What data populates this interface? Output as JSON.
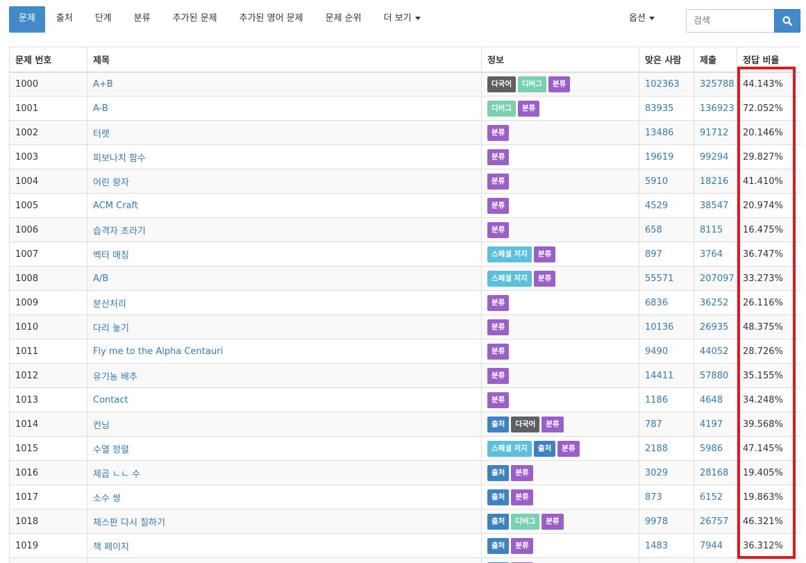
{
  "nav": {
    "tabs": [
      {
        "label": "문제",
        "active": true
      },
      {
        "label": "출처"
      },
      {
        "label": "단계"
      },
      {
        "label": "분류"
      },
      {
        "label": "추가된 문제"
      },
      {
        "label": "추가된 영어 문제"
      },
      {
        "label": "문제 순위"
      },
      {
        "label": "더 보기",
        "dropdown": true
      }
    ],
    "options_label": "옵션"
  },
  "search": {
    "placeholder": "검색",
    "button_icon": "search-icon"
  },
  "table": {
    "headers": [
      "문제 번호",
      "제목",
      "정보",
      "맞은 사람",
      "제출",
      "정답 비율"
    ],
    "rows": [
      {
        "id": "1000",
        "title": "A+B",
        "tags": [
          "다국어",
          "디버그",
          "분류"
        ],
        "solved": "102363",
        "submissions": "325788",
        "ratio": "44.143%"
      },
      {
        "id": "1001",
        "title": "A-B",
        "tags": [
          "디버그",
          "분류"
        ],
        "solved": "83935",
        "submissions": "136923",
        "ratio": "72.052%"
      },
      {
        "id": "1002",
        "title": "터렛",
        "tags": [
          "분류"
        ],
        "solved": "13486",
        "submissions": "91712",
        "ratio": "20.146%"
      },
      {
        "id": "1003",
        "title": "피보나치 함수",
        "tags": [
          "분류"
        ],
        "solved": "19619",
        "submissions": "99294",
        "ratio": "29.827%"
      },
      {
        "id": "1004",
        "title": "어린 왕자",
        "tags": [
          "분류"
        ],
        "solved": "5910",
        "submissions": "18216",
        "ratio": "41.410%"
      },
      {
        "id": "1005",
        "title": "ACM Craft",
        "tags": [
          "분류"
        ],
        "solved": "4529",
        "submissions": "38547",
        "ratio": "20.974%"
      },
      {
        "id": "1006",
        "title": "습격자 초라기",
        "tags": [
          "분류"
        ],
        "solved": "658",
        "submissions": "8115",
        "ratio": "16.475%"
      },
      {
        "id": "1007",
        "title": "벡터 매칭",
        "tags": [
          "스페셜 저지",
          "분류"
        ],
        "solved": "897",
        "submissions": "3764",
        "ratio": "36.747%"
      },
      {
        "id": "1008",
        "title": "A/B",
        "tags": [
          "스페셜 저지",
          "분류"
        ],
        "solved": "55571",
        "submissions": "207097",
        "ratio": "33.273%"
      },
      {
        "id": "1009",
        "title": "분산처리",
        "tags": [
          "분류"
        ],
        "solved": "6836",
        "submissions": "36252",
        "ratio": "26.116%"
      },
      {
        "id": "1010",
        "title": "다리 놓기",
        "tags": [
          "분류"
        ],
        "solved": "10136",
        "submissions": "26935",
        "ratio": "48.375%"
      },
      {
        "id": "1011",
        "title": "Fly me to the Alpha Centauri",
        "tags": [
          "분류"
        ],
        "solved": "9490",
        "submissions": "44052",
        "ratio": "28.726%"
      },
      {
        "id": "1012",
        "title": "유기농 배추",
        "tags": [
          "분류"
        ],
        "solved": "14411",
        "submissions": "57880",
        "ratio": "35.155%"
      },
      {
        "id": "1013",
        "title": "Contact",
        "tags": [
          "분류"
        ],
        "solved": "1186",
        "submissions": "4648",
        "ratio": "34.248%"
      },
      {
        "id": "1014",
        "title": "컨닝",
        "tags": [
          "출처",
          "다국어",
          "분류"
        ],
        "solved": "787",
        "submissions": "4197",
        "ratio": "39.568%"
      },
      {
        "id": "1015",
        "title": "수열 정렬",
        "tags": [
          "스페셜 저지",
          "출처",
          "분류"
        ],
        "solved": "2188",
        "submissions": "5986",
        "ratio": "47.145%"
      },
      {
        "id": "1016",
        "title": "제곱 ㄴㄴ 수",
        "tags": [
          "출처",
          "분류"
        ],
        "solved": "3029",
        "submissions": "28168",
        "ratio": "19.405%"
      },
      {
        "id": "1017",
        "title": "소수 쌍",
        "tags": [
          "출처",
          "분류"
        ],
        "solved": "873",
        "submissions": "6152",
        "ratio": "19.863%"
      },
      {
        "id": "1018",
        "title": "체스판 다시 칠하기",
        "tags": [
          "출처",
          "디버그",
          "분류"
        ],
        "solved": "9978",
        "submissions": "26757",
        "ratio": "46.321%"
      },
      {
        "id": "1019",
        "title": "책 페이지",
        "tags": [
          "출처",
          "분류"
        ],
        "solved": "1483",
        "submissions": "7944",
        "ratio": "36.312%"
      },
      {
        "id": "",
        "title": "",
        "tags": [
          "출처",
          "분류"
        ],
        "solved": "",
        "submissions": "",
        "ratio": ""
      }
    ]
  },
  "colors": {
    "primary": "#428bca",
    "link": "#337ab7",
    "tag_multilang": "#5f6063",
    "tag_debug": "#7ad1b2",
    "tag_classification": "#9b5fc9",
    "tag_special_judge": "#5bc0de",
    "tag_source": "#3d83c4",
    "highlight_box": "#e0191e"
  }
}
